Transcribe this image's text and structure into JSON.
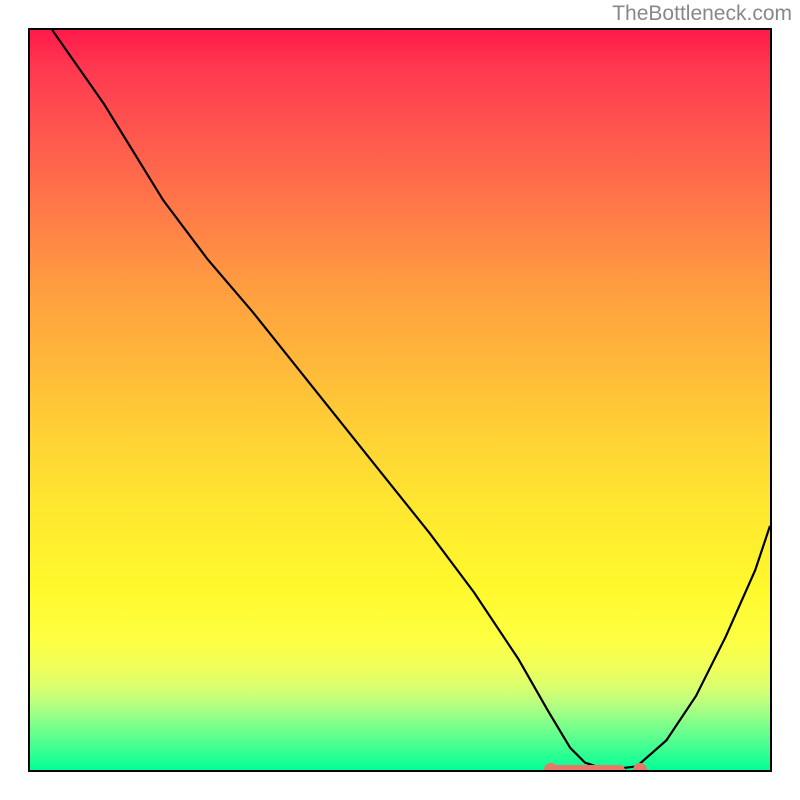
{
  "watermark": "TheBottleneck.com",
  "chart_data": {
    "type": "line",
    "title": "",
    "xlabel": "",
    "ylabel": "",
    "x_range": [
      0,
      100
    ],
    "y_range": [
      0,
      100
    ],
    "series": [
      {
        "name": "curve",
        "x": [
          3,
          10,
          18,
          24,
          30,
          38,
          46,
          54,
          60,
          66,
          70,
          73,
          75,
          78,
          82,
          86,
          90,
          94,
          98,
          100
        ],
        "y": [
          100,
          90,
          77,
          69,
          62,
          52,
          42,
          32,
          24,
          15,
          8,
          3,
          1,
          0,
          0.5,
          4,
          10,
          18,
          27,
          33
        ]
      }
    ],
    "markers": [
      {
        "x": 70,
        "y": 0
      },
      {
        "x": 82,
        "y": 0
      }
    ],
    "marker_bar": {
      "x_start": 70,
      "x_end": 80,
      "y": 0
    },
    "background_gradient": {
      "orientation": "vertical",
      "stops": [
        {
          "pos": 0,
          "color": "#ff1a4a"
        },
        {
          "pos": 50,
          "color": "#ffd235"
        },
        {
          "pos": 85,
          "color": "#feff40"
        },
        {
          "pos": 100,
          "color": "#00ff96"
        }
      ]
    }
  }
}
